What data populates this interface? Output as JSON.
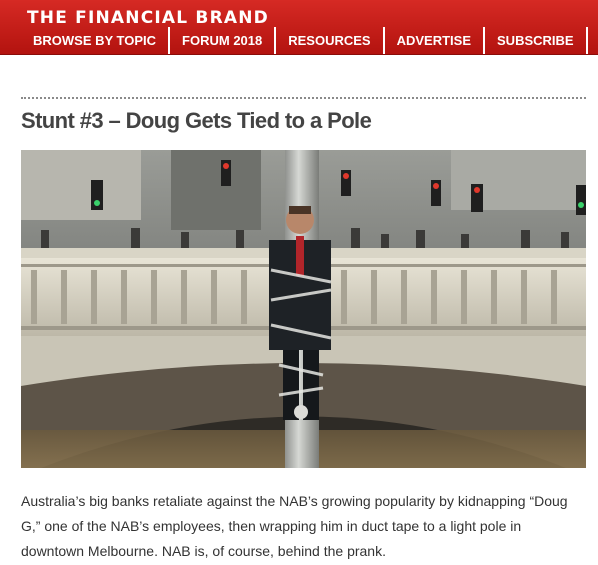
{
  "header": {
    "brand": "THE FINANCIAL BRAND",
    "nav": [
      {
        "label": "BROWSE BY TOPIC"
      },
      {
        "label": "FORUM 2018"
      },
      {
        "label": "RESOURCES"
      },
      {
        "label": "ADVERTISE"
      },
      {
        "label": "SUBSCRIBE"
      }
    ]
  },
  "article": {
    "title": "Stunt #3 – Doug Gets Tied to a Pole",
    "paragraph": "Australia’s big banks retaliate against the NAB’s growing popularity by kidnapping “Doug G,” one of the NAB’s employees, then wrapping him in duct tape to a light pole in downtown Melbourne. NAB is, of course, behind the prank."
  },
  "colors": {
    "header_red": "#c41e1a",
    "nav_text": "#ffffff",
    "title_text": "#444444",
    "body_text": "#333333"
  }
}
